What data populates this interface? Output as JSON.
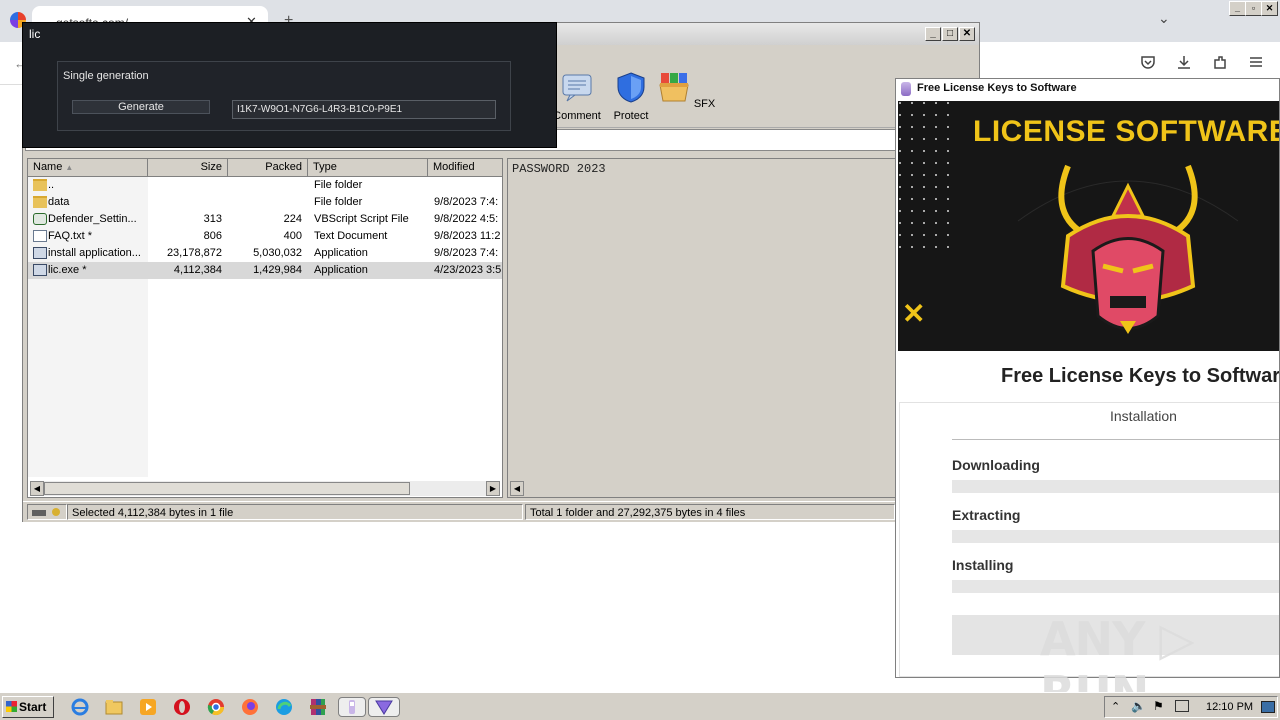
{
  "browser": {
    "tab_title": "getsofte.com/",
    "tab_close": "✕",
    "new_tab": "+",
    "back": "←",
    "tab_menu": "⌄",
    "toolbar_icons": [
      "pocket-icon",
      "download-icon",
      "extensions-icon",
      "menu-icon"
    ]
  },
  "winrar": {
    "controls": {
      "minimize": "_",
      "maximize": "□",
      "close": "✕"
    },
    "toolbar": [
      {
        "label": "Comment",
        "icon": "comment-icon"
      },
      {
        "label": "Protect",
        "icon": "shield-icon"
      },
      {
        "label": "SFX",
        "icon": "sfx-icon"
      }
    ],
    "columns": {
      "name": "Name",
      "size": "Size",
      "packed": "Packed",
      "type": "Type",
      "modified": "Modified"
    },
    "files": [
      {
        "name": "..",
        "size": "",
        "packed": "",
        "type": "File folder",
        "modified": "",
        "icon": "folder"
      },
      {
        "name": "data",
        "size": "",
        "packed": "",
        "type": "File folder",
        "modified": "9/8/2023 7:4:",
        "icon": "folder"
      },
      {
        "name": "Defender_Settin...",
        "size": "313",
        "packed": "224",
        "type": "VBScript Script File",
        "modified": "9/8/2022 4:5:",
        "icon": "vbs"
      },
      {
        "name": "FAQ.txt *",
        "size": "806",
        "packed": "400",
        "type": "Text Document",
        "modified": "9/8/2023 11:2",
        "icon": "doc"
      },
      {
        "name": "install application...",
        "size": "23,178,872",
        "packed": "5,030,032",
        "type": "Application",
        "modified": "9/8/2023 7:4:",
        "icon": "app"
      },
      {
        "name": "lic.exe *",
        "size": "4,112,384",
        "packed": "1,429,984",
        "type": "Application",
        "modified": "4/23/2023 3:5",
        "icon": "app",
        "selected": true
      }
    ],
    "comment_text": "PASSWORD 2023",
    "status_left": "Selected 4,112,384 bytes in 1 file",
    "status_right": "Total 1 folder and 27,292,375 bytes in 4 files"
  },
  "lic_dialog": {
    "title": "lic",
    "group_label": "Single generation",
    "generate_label": "Generate",
    "key_value": "I1K7-W9O1-N7G6-L4R3-B1C0-P9E1"
  },
  "installer": {
    "title": "Free License Keys to Software",
    "banner_text": "LICENSE SOFTWARE KE",
    "banner_mark": "✕",
    "heading": "Free License Keys to Softwar",
    "subheading": "Installation",
    "stages": [
      "Downloading",
      "Extracting",
      "Installing"
    ]
  },
  "watermark": "ANY ▷ RUN",
  "taskbar": {
    "start_label": "Start",
    "apps": [
      "ie-icon",
      "explorer-icon",
      "media-player-icon",
      "opera-icon",
      "chrome-icon",
      "firefox-icon",
      "edge-icon",
      "winrar-icon",
      "installer-icon",
      "triangle-app-icon"
    ],
    "clock": "12:10 PM"
  },
  "colors": {
    "banner_yellow": "#f0c419",
    "lic_bg": "#1c1f24",
    "chrome_bg": "#dee1e6"
  }
}
